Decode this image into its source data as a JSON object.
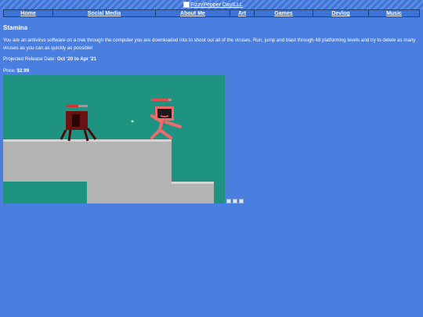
{
  "banner": {
    "alt_text": "FizzyPepper DayILLL"
  },
  "nav": {
    "home": "Home",
    "social": "Social Media",
    "about": "About Me",
    "art": "Art",
    "games": "Games",
    "devlog": "Devlog",
    "music": "Music"
  },
  "page": {
    "title": "Stamina",
    "description": "You are an antivirus software on a trek through the computer you are downloaded into to shoot out all of the viruses. Run, jump and blast through 48 platforming levels and try to delete as many viruses as you can as quickly as possible!",
    "release_label": "Projected Release Date: ",
    "release_value": "Oct '20 to Apr '21",
    "price_label": "Price: ",
    "price_value": "$2.99"
  },
  "colors": {
    "page_bg": "#4a7fe0",
    "game_bg": "#1f9382",
    "platform": "#b3b3b3",
    "player": "#f06a6a",
    "virus": "#6b1212"
  },
  "icons": [
    "broken-image-icon",
    "thumbnail-icon"
  ]
}
